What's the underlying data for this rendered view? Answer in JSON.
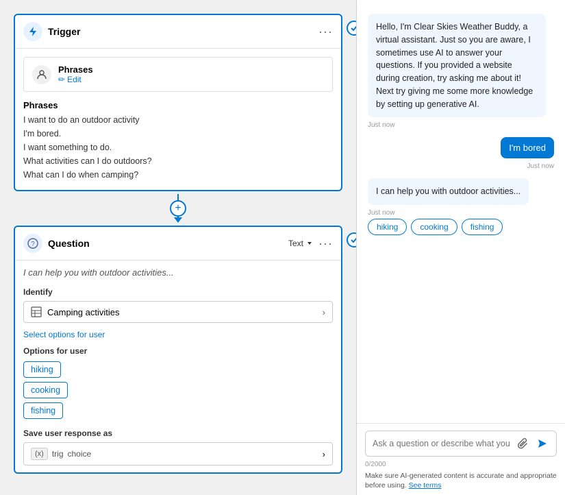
{
  "trigger": {
    "title": "Trigger",
    "phrases_title": "Phrases",
    "edit_label": "Edit",
    "phrases_heading": "Phrases",
    "phrase_1": "I want to do an outdoor activity",
    "phrase_2": "I'm bored.",
    "phrase_3": "I want something to do.",
    "phrase_4": "What activities can I do outdoors?",
    "phrase_5": "What can I do when camping?"
  },
  "question": {
    "title": "Question",
    "type": "Text",
    "preview_text": "I can help you with outdoor activities...",
    "identify_label": "Identify",
    "identify_value": "Camping activities",
    "select_options_link": "Select options for user",
    "options_label": "Options for user",
    "options": [
      "hiking",
      "cooking",
      "fishing"
    ],
    "save_label": "Save user response as",
    "var_x": "(x)",
    "var_trig": "trig",
    "var_choice": "choice"
  },
  "chat": {
    "bot_message_1": "Hello, I'm Clear Skies Weather Buddy, a virtual assistant. Just so you are aware, I sometimes use AI to answer your questions. If you provided a website during creation, try asking me about it! Next try giving me some more knowledge by setting up generative AI.",
    "timestamp_1": "Just now",
    "user_message_1": "I'm bored",
    "timestamp_2": "Just now",
    "bot_message_2": "I can help you with outdoor activities...",
    "timestamp_3": "Just now",
    "chat_options": [
      "hiking",
      "cooking",
      "fishing"
    ],
    "input_placeholder": "Ask a question or describe what you need",
    "counter": "0/2000",
    "footer_text": "Make sure AI-generated content is accurate and appropriate before using.",
    "footer_link": "See terms"
  },
  "icons": {
    "trigger": "⚡",
    "question": "?",
    "edit_pencil": "✏",
    "person": "👤",
    "chevron_right": "›",
    "chevron_down": "˅",
    "table_icon": "⊞",
    "attach": "📎",
    "send": "➤",
    "ellipsis": "···",
    "checkmark": "✓"
  }
}
